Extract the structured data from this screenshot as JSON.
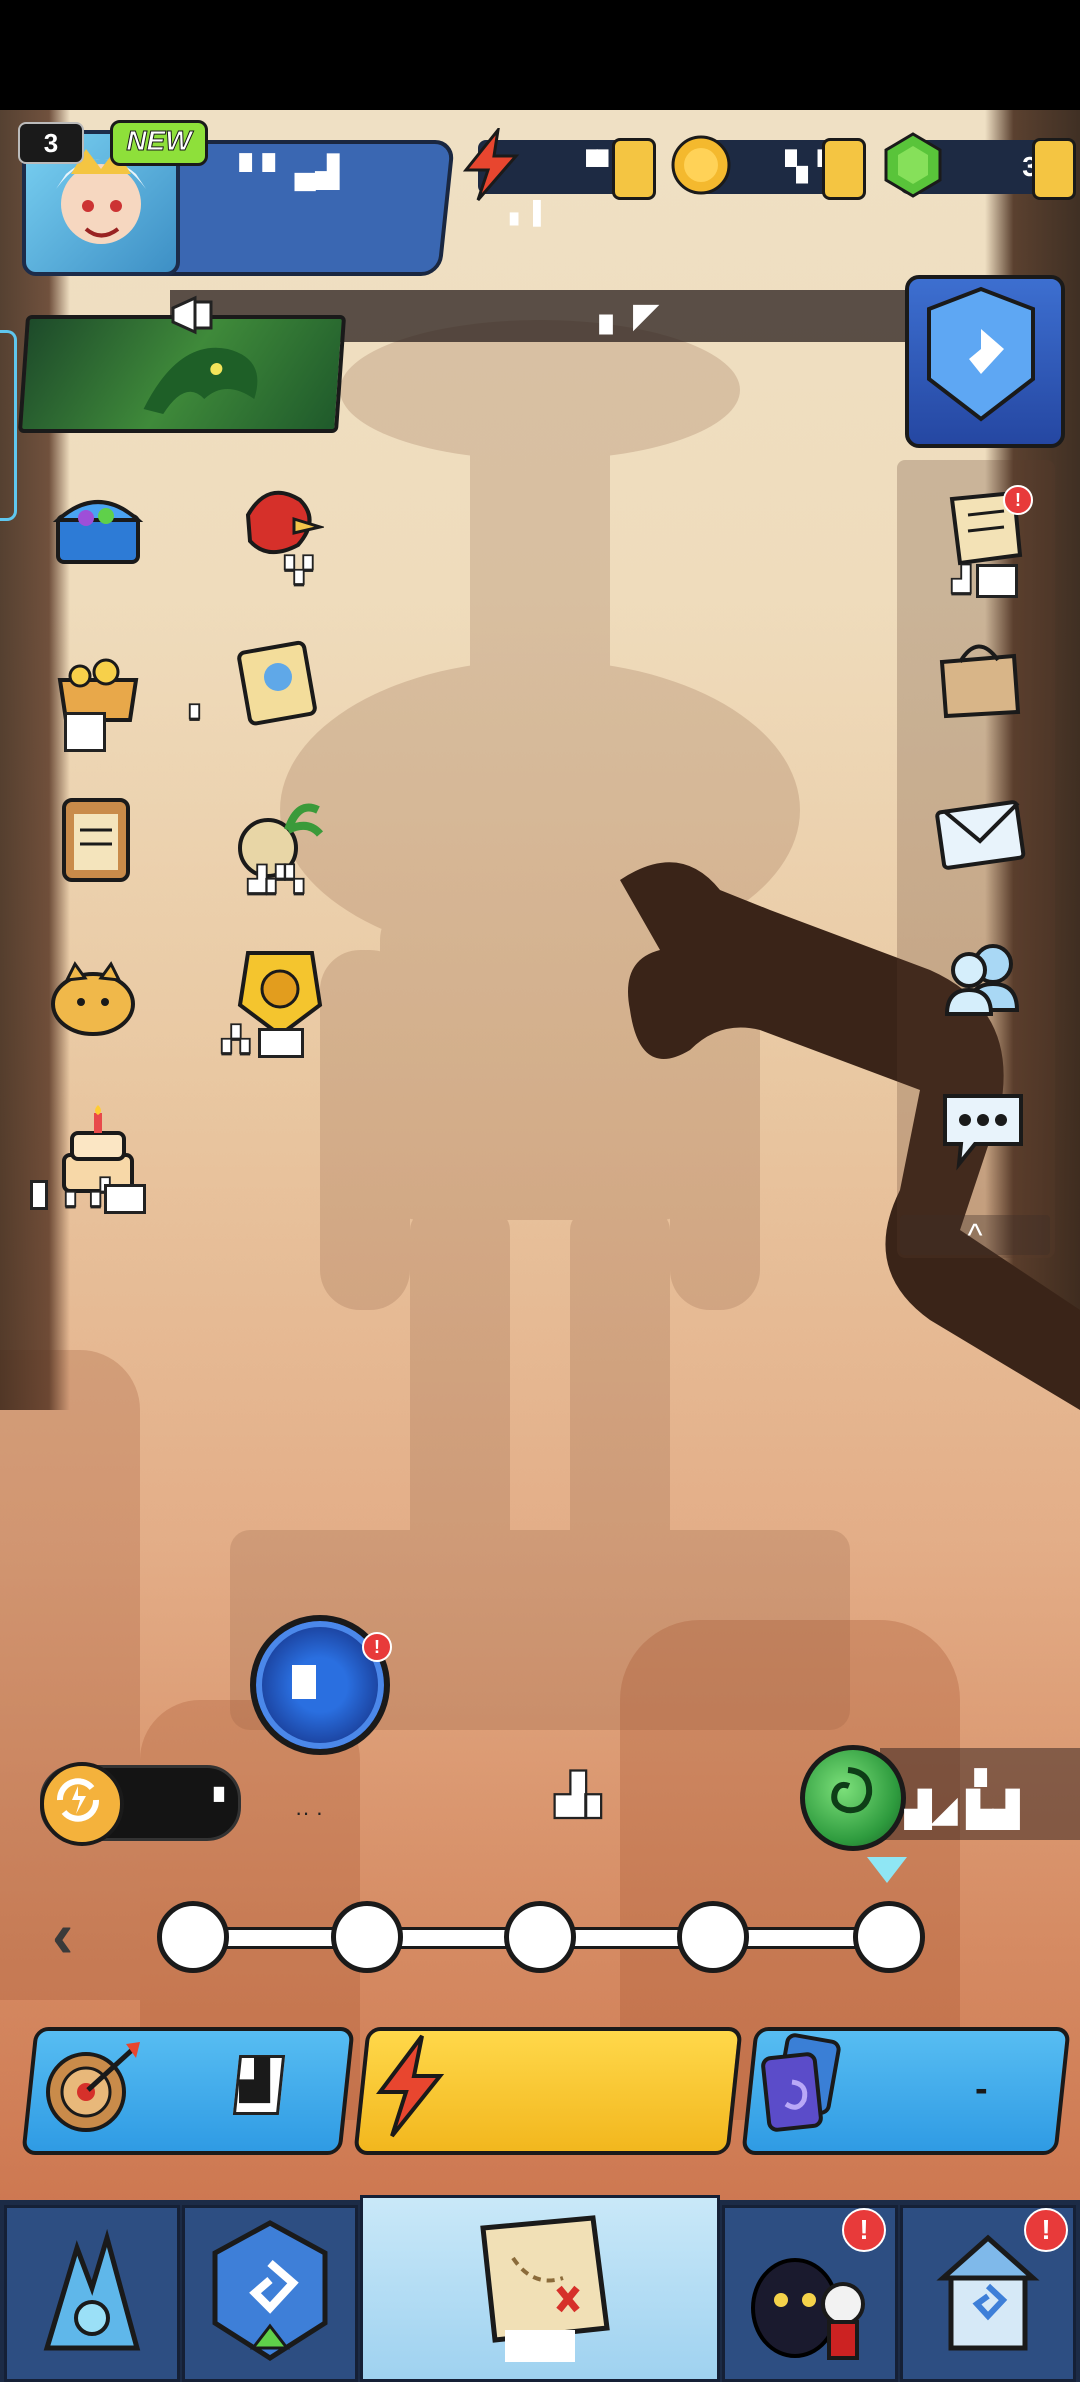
{
  "player": {
    "level": "3",
    "new_badge": "NEW",
    "name": "▘▘ ▄▟"
  },
  "resources": {
    "energy": "▝▘▚",
    "coins": "▚▝▘",
    "gems": "3",
    "energy_sub": "▖ ▌"
  },
  "announcement": {
    "text": "▖ ◤"
  },
  "left_menu": {
    "treasure_chest_label": "",
    "bird_label": "▚▘",
    "gold_pot_label": "",
    "gold_pot_badge": "▘",
    "book_label": "",
    "clipboard_label": "",
    "compass_label": "▟▞▚",
    "piggy_label": "",
    "card_label": "▞▖",
    "cake_label": "▖ ▞▖"
  },
  "right_menu": {
    "scroll_label": "▟",
    "collapse": "^"
  },
  "midfield": {
    "stamina_value": "▝",
    "stamina_sub": "·· ·",
    "center_label": "▟▖",
    "orb_label": "▟◢ ▙▟",
    "orb_top": "▖"
  },
  "progress": {
    "nodes": 5,
    "back": "‹"
  },
  "actions": {
    "dart_value": "▟",
    "cards_value": "-"
  },
  "nav": {
    "center_label": ""
  },
  "colors": {
    "accent_blue": "#3a67b2",
    "button_blue": "#2f9be4",
    "button_yellow": "#f2b71e",
    "nav_dark": "#1c2b46",
    "alert_red": "#e83a3a"
  }
}
